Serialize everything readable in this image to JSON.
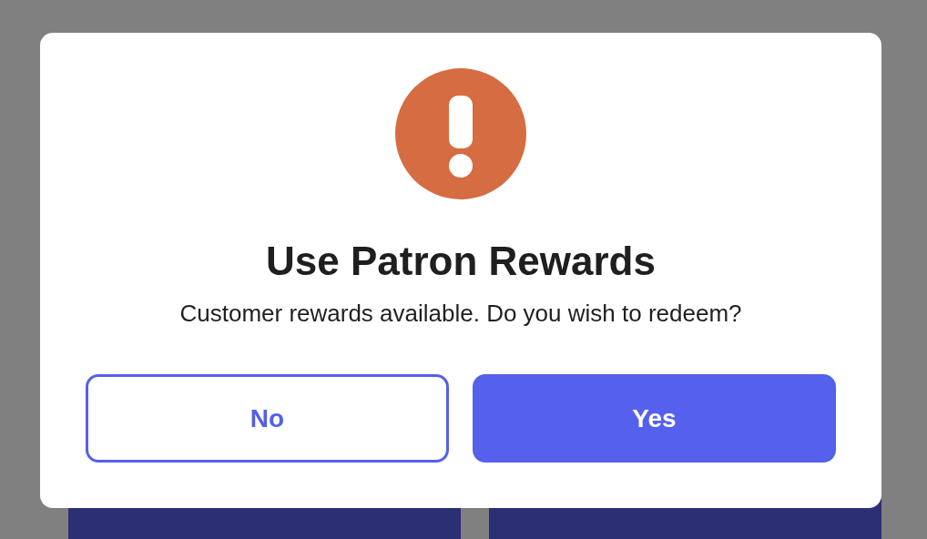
{
  "dialog": {
    "title": "Use Patron Rewards",
    "message": "Customer rewards available. Do you wish to redeem?",
    "buttons": [
      {
        "label": "No",
        "kind": "secondary"
      },
      {
        "label": "Yes",
        "kind": "primary"
      }
    ]
  }
}
